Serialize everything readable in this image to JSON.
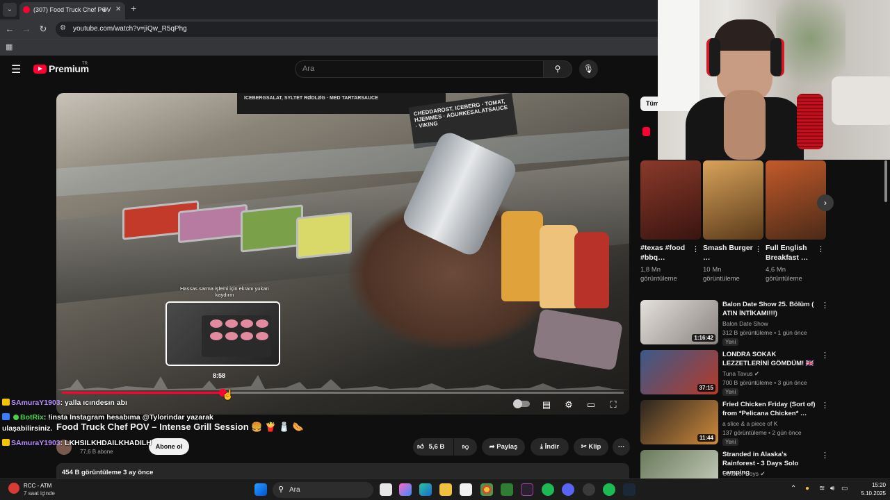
{
  "browser": {
    "tab_title": "(307) Food Truck Chef POV",
    "url": "youtube.com/watch?v=jiQw_R5qPhg"
  },
  "header": {
    "logo_text": "Premium",
    "logo_sup": "TR",
    "search_placeholder": "Ara"
  },
  "player": {
    "sign_text": "ICEBERGSALAT, SYLTET RØDLØG · MED TARTARSAUCE",
    "sign2_text": "CHEDDAROST, ICEBERG · TOMAT, HJEMMES · AGURKESALATSAUCE · VIKING",
    "hint_text": "Hassas sarma işlemi için ekranı yukarı kaydırın",
    "preview_time": "8:58",
    "progress_fraction": 0.286
  },
  "video": {
    "title": "Food Truck Chef POV – Intense Grill Session 🍔 🍟 🧂 🌭",
    "subscribers": "77,6 B abone",
    "subscribe_label": "Abone ol",
    "likes": "5,6 B",
    "share_label": "Paylaş",
    "download_label": "İndir",
    "clip_label": "Klip",
    "views_date": "454 B görüntüleme  3 ay önce"
  },
  "chat": [
    {
      "user": "SAmuraY1903",
      "msg": ": yalla ıcındesın abı",
      "badge_color": "#f5c400",
      "name_color": "#b68cff"
    },
    {
      "user": "BotRix",
      "msg": ": !insta Instagram hesabıma @Tylorindar yazarak",
      "badge_color": "#3a7bff",
      "name_color": "#4ad14a"
    },
    {
      "user": "",
      "msg": "ulaşabilirsiniz.",
      "badge_color": "",
      "name_color": ""
    },
    {
      "user": "SAmuraY1903",
      "msg": ": LKHSILKHDAILKHADILH",
      "badge_color": "#f5c400",
      "name_color": "#b68cff"
    }
  ],
  "sidebar": {
    "chip_label": "Tüm",
    "shorts": [
      {
        "title": "#texas #food #bbq…",
        "views": "1,8 Mn",
        "views_unit": "görüntüleme",
        "color": "#6b2a22"
      },
      {
        "title": "Smash Burger …",
        "views": "10 Mn",
        "views_unit": "görüntüleme",
        "color": "#b57a3a"
      },
      {
        "title": "Full English Breakfast …",
        "views": "4,6 Mn",
        "views_unit": "görüntüleme",
        "color": "#9a3a22"
      }
    ],
    "recommended": [
      {
        "title": "Balon Date Show 25. Bölüm ( ATIN İNTİKAMI!!!)",
        "channel": "Balon Date Show",
        "meta": "312 B görüntüleme • 1 gün önce",
        "duration": "1:16:42",
        "badge": "Yeni",
        "color": "#c9c4bf"
      },
      {
        "title": "LONDRA SOKAK LEZZETLERİNİ GÖMDÜM! 🇬🇧",
        "channel": "Tuna Tavus ✔",
        "meta": "700 B görüntüleme • 3 gün önce",
        "duration": "37:15",
        "badge": "Yeni",
        "color": "#a33a2a"
      },
      {
        "title": "Fried Chicken Friday (Sort of) from *Pelicana Chicken* …",
        "channel": "a slice & a piece of K",
        "meta": "137 görüntüleme • 2 gün önce",
        "duration": "11:44",
        "badge": "Yeni",
        "color": "#7a4a2a"
      },
      {
        "title": "Stranded in Alaska's Rainforest - 3 Days Solo camping",
        "channel": "Outdoor Boys ✔",
        "meta": "",
        "duration": "",
        "badge": "",
        "color": "#5e6a56"
      }
    ]
  },
  "taskbar": {
    "weather_title": "RCC - ATM",
    "weather_sub": "7 saat içinde",
    "search_label": "Ara",
    "time": "15:20",
    "date": "5.10.2025"
  }
}
